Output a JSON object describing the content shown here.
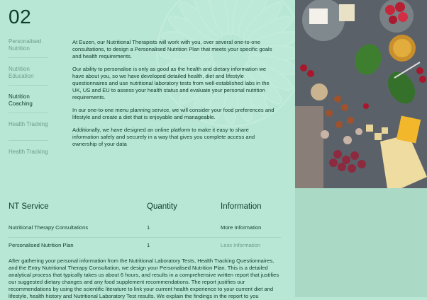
{
  "page": {
    "step_number": "02"
  },
  "nav": {
    "items": [
      {
        "label": "Personalised Nutrition"
      },
      {
        "label": "Nutrition Education"
      },
      {
        "label": "Nutrition Coaching"
      },
      {
        "label": "Health Tracking"
      },
      {
        "label": "Health Tracking"
      }
    ]
  },
  "content": {
    "paragraphs": [
      "At Euzen, our Nutritional Therapists will work with you, over several one-to-one consultations, to design a Personalised Nutrition Plan that meets your specific goals and health requirements.",
      "Our ability to personalise is only as good as the health and dietary information we have about you, so we have developed detailed health, diet and lifestyle questionnaires and use nutritional laboratory tests from well-established labs in the UK, US and EU to assess your health status and evaluate your personal nutrition requirements.",
      "In our one-to-one menu planning service, we will consider your food preferences and lifestyle and create a diet that is enjoyable and manageable.",
      "Additionally, we have designed an online platform to make it easy to share information safely and securely in a way that gives you complete access and ownership of your data"
    ]
  },
  "table": {
    "headers": {
      "service": "NT Service",
      "quantity": "Quantity",
      "information": "Information"
    },
    "rows": [
      {
        "service": "Nutritional Therapy Consultations",
        "quantity": "1",
        "information": "More Information"
      },
      {
        "service": "Personalised Nutrition Plan",
        "quantity": "1",
        "information": "Less Information"
      }
    ]
  },
  "bottom": {
    "text": "After gathering your personal information from the Nutritional Laboratory Tests, Health Tracking Questionnaires, and the Entry Nutritional Therapy Consultation, we design your Personalised Nutrition Plan. This is a detailed analytical process that typically takes us about 6 hours, and results in a comprehensive written report that justifies our suggested dietary changes and any food supplement recommendations. The report justifies our recommendations by using the scientific literature to link your current health experience to your current diet and lifestyle, health history and Nutritional Laboratory Test results. We explain the findings in the report to you"
  },
  "colors": {
    "background": "#b8e8d5",
    "accent_text": "#0f3b2e",
    "muted_text": "#6b9d8a"
  },
  "image": {
    "name": "food-platter-photo"
  }
}
